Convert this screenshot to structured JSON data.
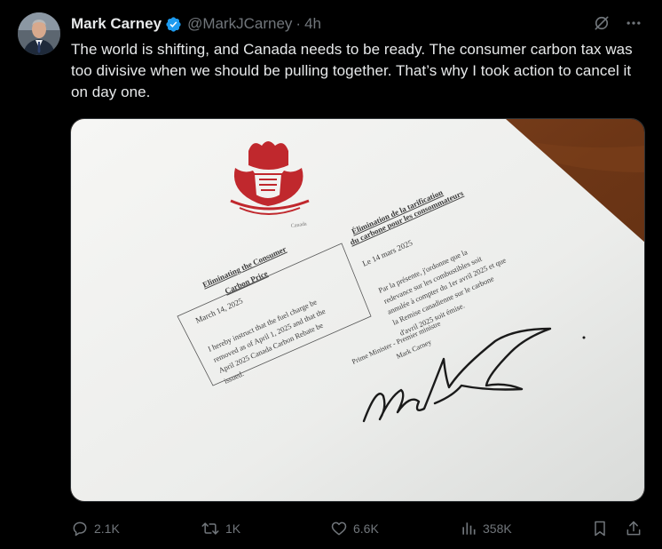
{
  "author": {
    "display_name": "Mark Carney",
    "handle": "@MarkJCarney",
    "separator": "·",
    "time": "4h",
    "verified_color": "#1d9bf0"
  },
  "tweet": {
    "text": "The world is shifting, and Canada needs to be ready. The consumer carbon tax was too divisive when we should be pulling together. That’s why I took action to cancel it on day one."
  },
  "media": {
    "document": {
      "crest_caption": "Canada",
      "left_column": {
        "heading_line1": "Eliminating the Consumer",
        "heading_line2": "Carbon Price",
        "date": "March 14, 2025",
        "body": [
          "I hereby instruct that the fuel charge be",
          "removed as of April 1, 2025 and that the",
          "April 2025 Canada Carbon Rebate be",
          "issued."
        ]
      },
      "right_column": {
        "heading_line1": "Élimination de la tarification",
        "heading_line2": "du carbone pour les consommateurs",
        "date": "Le 14 mars 2025",
        "body": [
          "Par la présente, j'ordonne que la",
          "redevance sur les combustibles soit",
          "annulée à compter du 1er avril 2025 et que",
          "la Remise canadienne sur le carbone",
          "d'avril 2025 soit émise."
        ]
      },
      "signature_title": "Prime Minister - Premier ministre",
      "signature_name": "Mark Carney",
      "crest_color": "#c0282d"
    }
  },
  "actions": {
    "replies": "2.1K",
    "reposts": "1K",
    "likes": "6.6K",
    "views": "358K"
  },
  "icons": {
    "verified": "verified-badge-icon",
    "grok": "grok-icon",
    "more": "more-icon",
    "reply": "reply-icon",
    "repost": "repost-icon",
    "like": "heart-icon",
    "views": "views-icon",
    "bookmark": "bookmark-icon",
    "share": "share-icon"
  }
}
